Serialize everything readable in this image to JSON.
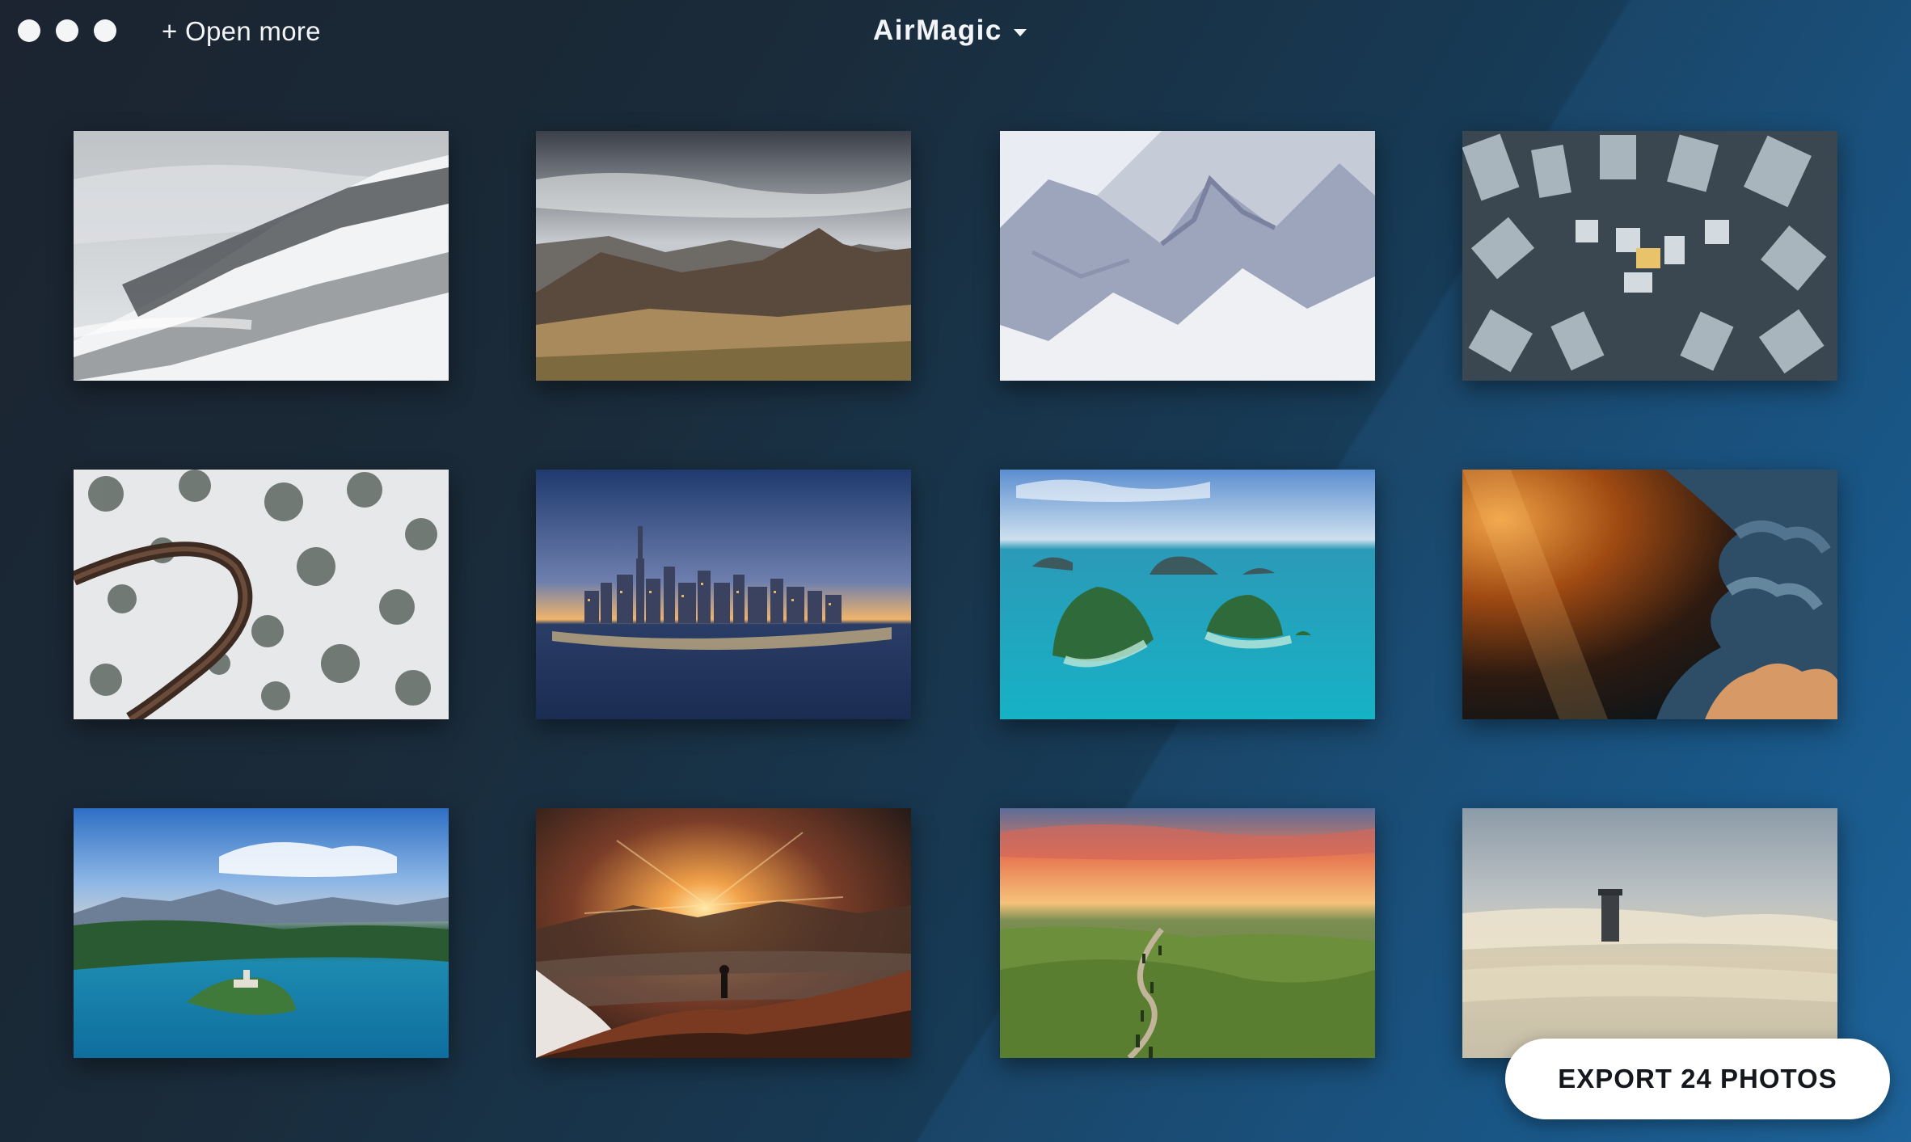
{
  "app": {
    "title": "AirMagic",
    "open_more_label": "+ Open more",
    "export_label": "EXPORT 24 PHOTOS"
  },
  "window_controls": [
    "close-icon",
    "minimize-icon",
    "zoom-icon"
  ],
  "photos": [
    {
      "subject": "snowy-mountain-forest-fog"
    },
    {
      "subject": "rocky-mountain-ridge-sunset"
    },
    {
      "subject": "aerial-snowy-mountains"
    },
    {
      "subject": "aerial-city-skyscrapers"
    },
    {
      "subject": "aerial-winding-road-snow-forest"
    },
    {
      "subject": "city-skyline-dusk"
    },
    {
      "subject": "tropical-islands-turquoise-sea"
    },
    {
      "subject": "golden-light-through-clouds"
    },
    {
      "subject": "lake-island-church-mountains"
    },
    {
      "subject": "hiker-sunset-mountain-peak"
    },
    {
      "subject": "rolling-hills-cypress-road-sunset"
    },
    {
      "subject": "tower-above-fog"
    }
  ],
  "colors": {
    "background_dark": "#1b2430",
    "background_blue": "#1a5f93",
    "text": "#f3f5f8",
    "button_bg": "#ffffff",
    "button_text": "#14181d"
  }
}
